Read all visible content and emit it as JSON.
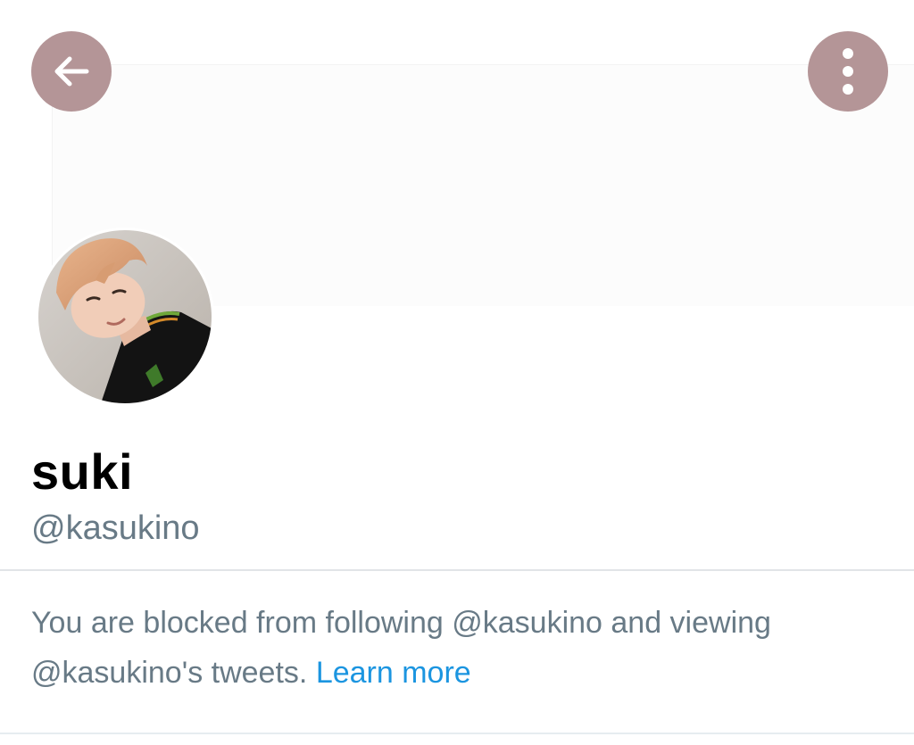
{
  "header": {
    "back_icon": "arrow-left-icon",
    "more_icon": "vertical-ellipsis-icon",
    "button_color": "#b49597"
  },
  "profile": {
    "display_name": "suki",
    "handle": "@kasukino"
  },
  "notice": {
    "message": "You are blocked from following @kasukino and viewing @kasukino's tweets.",
    "link_label": "Learn more",
    "text_color": "#687a86",
    "link_color": "#1b95e0"
  }
}
